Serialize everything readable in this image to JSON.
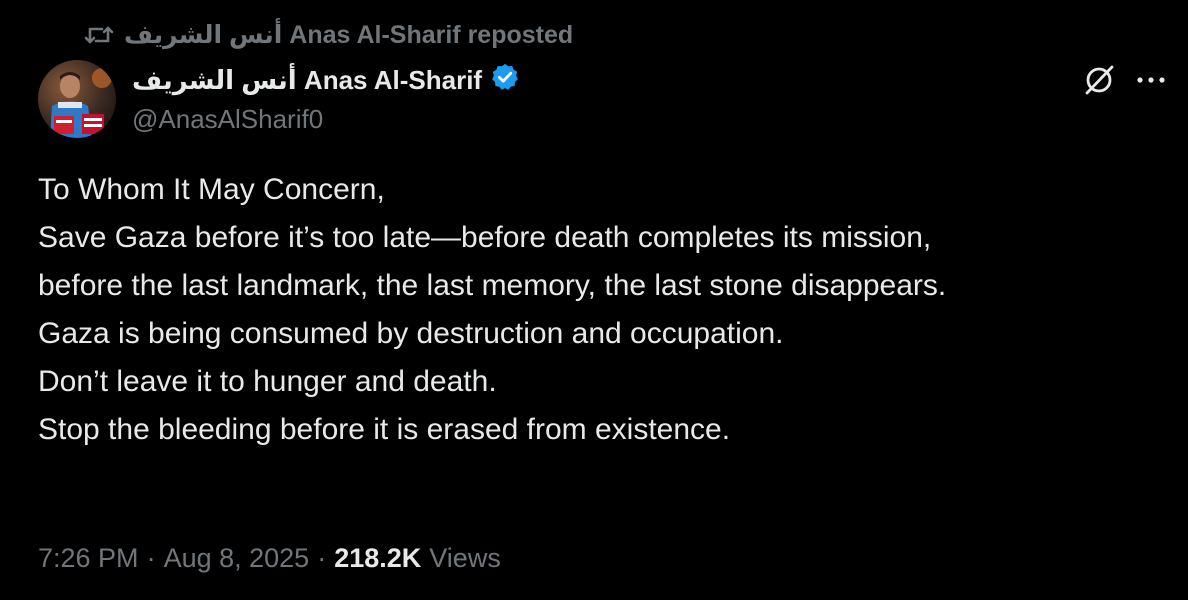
{
  "repost": {
    "icon": "repost-icon",
    "label": "أنس الشريف Anas Al-Sharif reposted"
  },
  "author": {
    "avatar": "avatar-photo",
    "display_name": "أنس الشريف Anas Al-Sharif",
    "verified_icon": "verified-badge-icon",
    "verified_color": "#1d9bf0",
    "handle": "@AnasAlSharif0"
  },
  "actions": {
    "grok_icon": "grok-icon",
    "more_icon": "more-icon"
  },
  "post": {
    "lines": [
      "To Whom It May Concern,",
      "",
      "Save Gaza before it’s too late—before death completes its mission,",
      "before the last landmark, the last memory, the last stone disappears.",
      "Gaza is being consumed by destruction and occupation.",
      "Don’t leave it to hunger and death.",
      "Stop the bleeding before it is erased from existence."
    ]
  },
  "meta": {
    "time": "7:26 PM",
    "separator": "·",
    "date": "Aug 8, 2025",
    "views_count": "218.2K",
    "views_label": "Views"
  },
  "colors": {
    "background": "#000000",
    "primary_text": "#e7e9ea",
    "secondary_text": "#71767b",
    "accent": "#1d9bf0"
  }
}
